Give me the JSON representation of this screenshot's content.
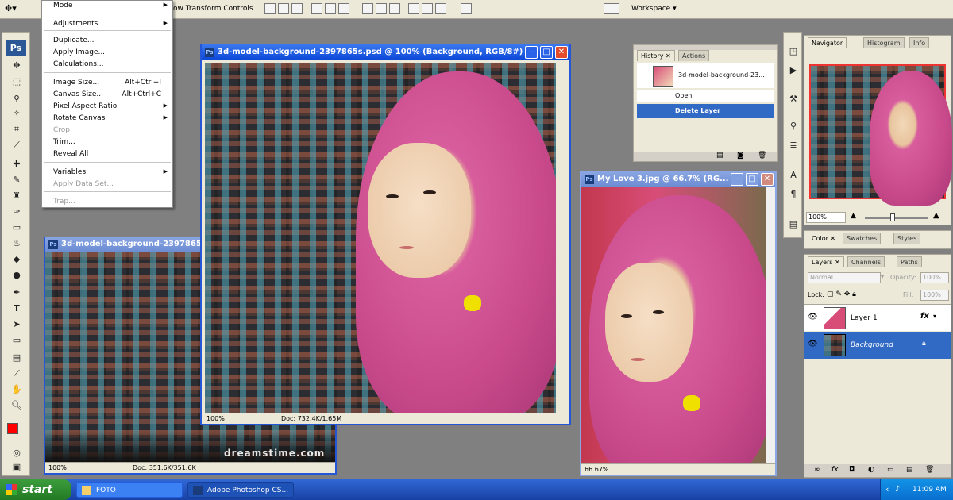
{
  "options_bar": {
    "show_transform_label": "ow Transform Controls",
    "workspace_label": "Workspace"
  },
  "menu": {
    "items": [
      {
        "label": "Mode",
        "shortcut": "",
        "submenu": true,
        "disabled": false
      },
      {
        "label": "Adjustments",
        "shortcut": "",
        "submenu": true,
        "disabled": false
      },
      {
        "label": "Duplicate...",
        "shortcut": "",
        "submenu": false,
        "disabled": false
      },
      {
        "label": "Apply Image...",
        "shortcut": "",
        "submenu": false,
        "disabled": false
      },
      {
        "label": "Calculations...",
        "shortcut": "",
        "submenu": false,
        "disabled": false
      },
      {
        "label": "Image Size...",
        "shortcut": "Alt+Ctrl+I",
        "submenu": false,
        "disabled": false
      },
      {
        "label": "Canvas Size...",
        "shortcut": "Alt+Ctrl+C",
        "submenu": false,
        "disabled": false
      },
      {
        "label": "Pixel Aspect Ratio",
        "shortcut": "",
        "submenu": true,
        "disabled": false
      },
      {
        "label": "Rotate Canvas",
        "shortcut": "",
        "submenu": true,
        "disabled": false
      },
      {
        "label": "Crop",
        "shortcut": "",
        "submenu": false,
        "disabled": true
      },
      {
        "label": "Trim...",
        "shortcut": "",
        "submenu": false,
        "disabled": false
      },
      {
        "label": "Reveal All",
        "shortcut": "",
        "submenu": false,
        "disabled": false
      },
      {
        "label": "Variables",
        "shortcut": "",
        "submenu": true,
        "disabled": false
      },
      {
        "label": "Apply Data Set...",
        "shortcut": "",
        "submenu": false,
        "disabled": true
      },
      {
        "label": "Trap...",
        "shortcut": "",
        "submenu": false,
        "disabled": true
      }
    ]
  },
  "win_left": {
    "title": "3d-model-background-2397865.",
    "zoom": "100%",
    "doc": "Doc: 351.6K/351.6K"
  },
  "win_main": {
    "title": "3d-model-background-2397865s.psd @ 100% (Background, RGB/8#)",
    "zoom": "100%",
    "doc": "Doc: 732.4K/1.65M"
  },
  "win_right": {
    "title": "My Love 3.jpg @ 66.7% (RG...",
    "zoom": "66.67%"
  },
  "watermark": "dreamstime.com",
  "history": {
    "tabs": [
      "History",
      "Actions"
    ],
    "snapshot": "3d-model-background-23...",
    "steps": [
      "Open",
      "Delete Layer"
    ]
  },
  "navigator": {
    "tabs": [
      "Navigator",
      "Histogram",
      "Info"
    ],
    "zoom": "100%"
  },
  "color_panel": {
    "tabs": [
      "Color",
      "Swatches",
      "Styles"
    ]
  },
  "layers": {
    "tabs": [
      "Layers",
      "Channels",
      "Paths"
    ],
    "blend_mode": "Normal",
    "opacity_label": "Opacity:",
    "opacity": "100%",
    "lock_label": "Lock:",
    "fill_label": "Fill:",
    "fill": "100%",
    "items": [
      {
        "name": "Layer 1"
      },
      {
        "name": "Background"
      }
    ]
  },
  "taskbar": {
    "start": "start",
    "tasks": [
      "FOTO",
      "Adobe Photoshop CS..."
    ],
    "time": "11:09 AM"
  },
  "colors": {
    "accent": "#2456d8",
    "selection": "#316ac5",
    "foreground": "#ff0000"
  }
}
